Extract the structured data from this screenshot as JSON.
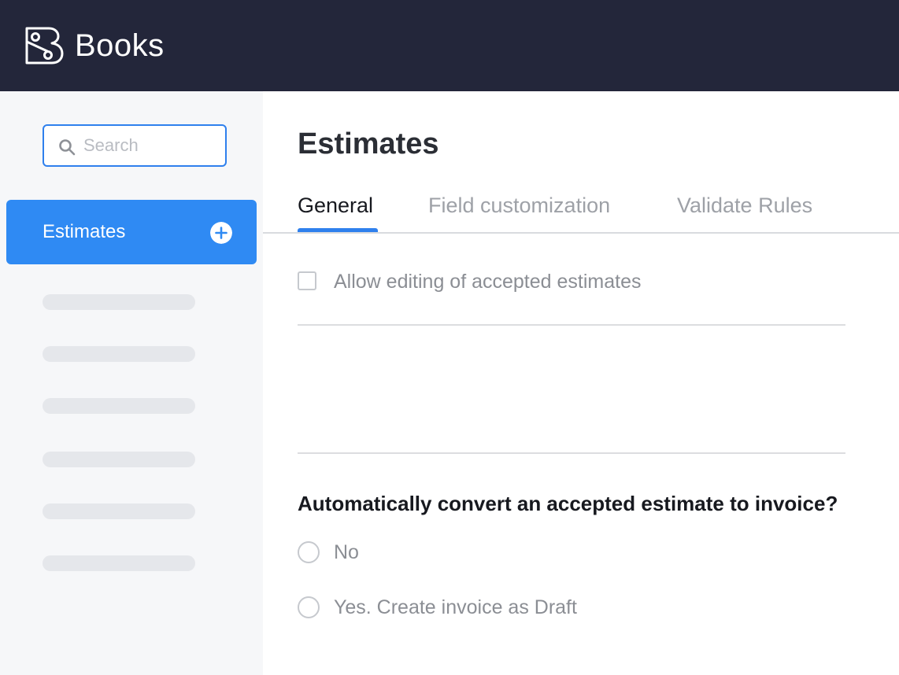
{
  "app": {
    "title": "Books",
    "logo_icon": "books-logo-icon"
  },
  "colors": {
    "topbar": "#23263a",
    "accent": "#2f8af3",
    "sidebar_bg": "#f6f7f9",
    "muted_text": "#8b8e94"
  },
  "sidebar": {
    "search": {
      "placeholder": "Search",
      "value": ""
    },
    "active_item": {
      "label": "Estimates",
      "action_icon": "plus-circle-icon"
    }
  },
  "main": {
    "title": "Estimates",
    "tabs": [
      {
        "label": "General",
        "active": true
      },
      {
        "label": "Field customization",
        "active": false
      },
      {
        "label": "Validate Rules",
        "active": false
      }
    ],
    "allow_editing": {
      "label": "Allow editing of accepted estimates",
      "checked": false
    },
    "convert_question": {
      "label": "Automatically convert an accepted estimate to invoice?",
      "options": [
        {
          "label": "No",
          "selected": false
        },
        {
          "label": "Yes. Create invoice as Draft",
          "selected": false
        }
      ]
    }
  }
}
